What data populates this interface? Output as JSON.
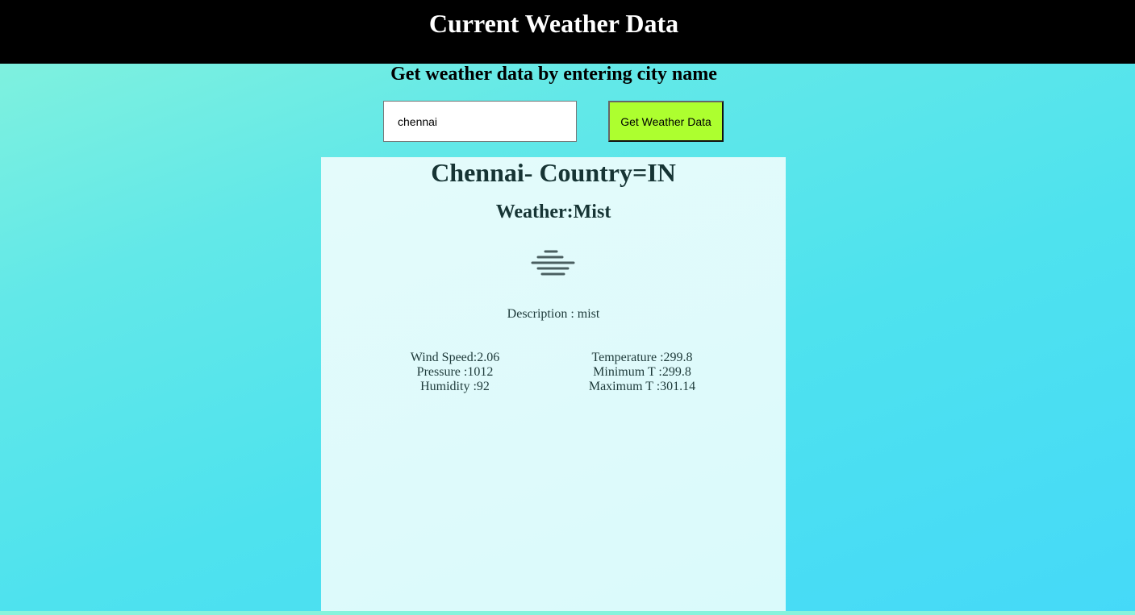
{
  "header": {
    "title": "Current Weather Data"
  },
  "search": {
    "prompt": "Get weather data by entering city name",
    "city_value": "chennai",
    "button_label": "Get Weather Data"
  },
  "result": {
    "city_heading": "Chennai- Country=IN",
    "weather_main": "Weather:Mist",
    "icon": "mist-icon",
    "description": "Description : mist",
    "left_stats": [
      "Wind Speed:2.06",
      "Pressure :1012",
      "Humidity :92"
    ],
    "right_stats": [
      "Temperature :299.8",
      "Minimum T :299.8",
      "Maximum T :301.14"
    ]
  },
  "colors": {
    "header_bg": "#000000",
    "button_bg": "#adff2f",
    "panel_bg": "#e0fafb",
    "page_gradient_start": "#86f3dc",
    "page_gradient_end": "#45d9f8"
  }
}
